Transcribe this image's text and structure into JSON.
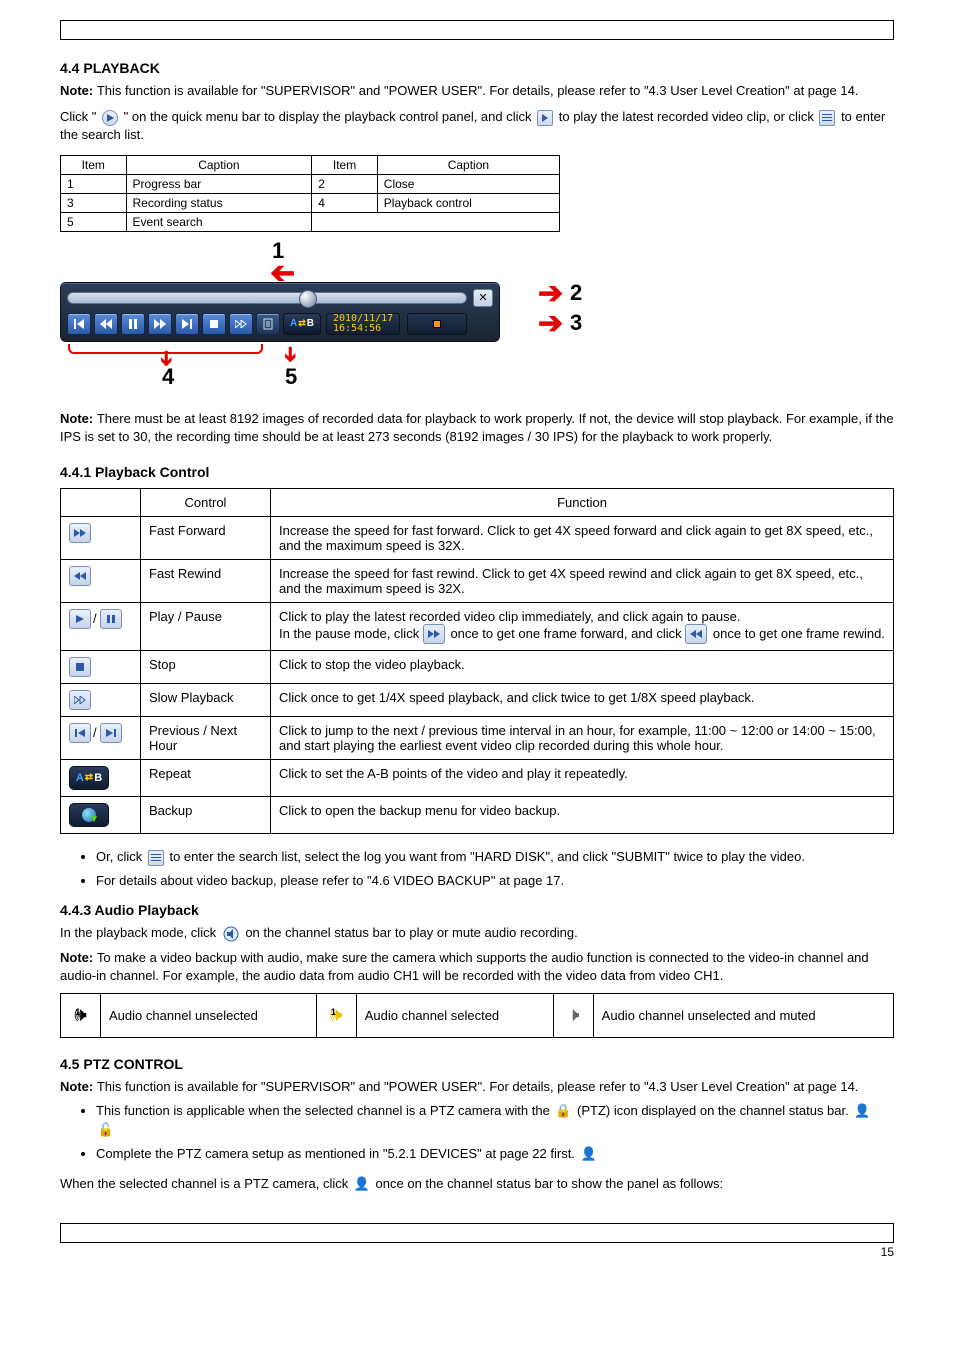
{
  "page_header_blank": "",
  "section_playback": {
    "title": "4.4 PLAYBACK",
    "intro_prefix": "Note: ",
    "intro": "This function is available for \"SUPERVISOR\" and \"POWER USER\". For details, please refer to \"4.3 User Level Creation\" at page 14.",
    "body1_a": "Click \"",
    "body1_icon_label": "playback-button",
    "body1_b": "\" on the quick menu bar to display the playback control panel, and click ",
    "body1_c": " to play the latest recorded video clip, or click ",
    "body1_d": " to enter the search list.",
    "note2_prefix": "Note: ",
    "note2": "There must be at least 8192 images of recorded data for playback to work properly. If not, the device will stop playback. For example, if the IPS is set to 30, the recording time should be at least 273 seconds (8192 images / 30 IPS) for the playback to work properly.",
    "table_header": [
      "Item",
      "Caption",
      "Item",
      "Caption"
    ],
    "table_rows": [
      [
        "1",
        "Progress bar",
        "2",
        "Close"
      ],
      [
        "3",
        "Recording status",
        "4",
        "Playback control"
      ]
    ],
    "table_last": [
      "5",
      "Event search"
    ],
    "timestamp": {
      "date": "2010/11/17",
      "time": "16:54:56"
    },
    "labels": {
      "1": "1",
      "2": "2",
      "3": "3",
      "4": "4",
      "5": "5"
    }
  },
  "section_control": {
    "title": "4.4.1 Playback Control",
    "header": [
      "",
      "Control",
      "Function"
    ],
    "rows": [
      {
        "name": "Fast Forward",
        "desc": "Increase the speed for fast forward. Click to get 4X speed forward and click again to get 8X speed, etc., and the maximum speed is 32X."
      },
      {
        "name": "Fast Rewind",
        "desc": "Increase the speed for fast rewind. Click to get 4X speed rewind and click again to get 8X speed, etc., and the maximum speed is 32X."
      },
      {
        "name": "Play / Pause",
        "desc_a": "Click to play the latest recorded video clip immediately, and click again to pause.\nIn the pause mode, click ",
        "desc_b": " once to get one frame forward, and click ",
        "desc_c": " once to get one frame rewind."
      },
      {
        "name": "Stop",
        "desc": "Click to stop the video playback."
      },
      {
        "name": "Slow Playback",
        "desc": "Click once to get 1/4X speed playback, and click twice to get 1/8X speed playback."
      },
      {
        "name": "Previous / Next Hour",
        "desc": "Click to jump to the next / previous time interval in an hour, for example, 11:00 ~ 12:00 or 14:00 ~ 15:00, and start playing the earliest event video clip recorded during this whole hour."
      },
      {
        "name": "Repeat",
        "desc": "Click to set the A-B points of the video and play it repeatedly."
      },
      {
        "name": "Backup",
        "desc": "Click to open the backup menu for video backup."
      }
    ],
    "notes": [
      {
        "a": "Or, click ",
        "b": " to enter the search list, select the log you want from \"HARD DISK\", and click \"SUBMIT\" twice to play the video."
      },
      {
        "a": "",
        "b": "For details about video backup, please refer to \"4.6 VIDEO BACKUP\" at page 17."
      }
    ]
  },
  "section_audio": {
    "title": "4.4.3 Audio Playback",
    "body": "In the playback mode, click ",
    "body_b": " on the channel status bar to play or mute audio recording.",
    "note_prefix": "Note: ",
    "note": "To make a video backup with audio, make sure the camera which supports the audio function is connected to the video-in channel and audio-in channel. For example, the audio data from audio CH1 will be recorded with the video data from video CH1.",
    "cols": [
      "Audio channel unselected",
      "Audio channel selected",
      "Audio channel unselected and muted"
    ]
  },
  "section_ptz": {
    "title": "4.5 PTZ CONTROL",
    "notes": [
      {
        "a": "This function is available for \"SUPERVISOR\" and \"POWER USER\". For details, please refer to \"4.3 User Level Creation\" at page 14."
      },
      {
        "a": "This function is applicable when the selected channel is a PTZ camera with the ",
        "b": " (PTZ) icon displayed on the channel status bar."
      },
      {
        "a": "Complete the PTZ camera setup as mentioned in \"5.2.1 DEVICES\" at page 22 first."
      }
    ],
    "body_a": "When the selected channel is a PTZ camera, click ",
    "body_b": " once on the channel status bar to show the panel as follows:",
    "icons": {
      "lock": "lock",
      "ptz": "ptz",
      "ptz2": "ptz"
    }
  },
  "footer_page": "15"
}
